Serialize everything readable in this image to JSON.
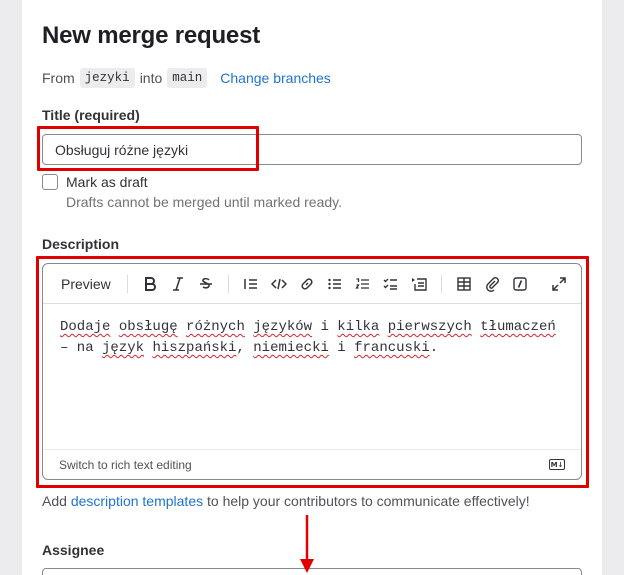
{
  "page": {
    "title": "New merge request"
  },
  "branches": {
    "from_label": "From",
    "source": "jezyki",
    "into_label": "into",
    "target": "main",
    "change_link": "Change branches"
  },
  "title_field": {
    "label": "Title (required)",
    "value": "Obsługuj różne języki"
  },
  "draft": {
    "label": "Mark as draft",
    "help": "Drafts cannot be merged until marked ready."
  },
  "description": {
    "label": "Description",
    "preview_tab": "Preview",
    "toolbar_icons": [
      "bold-icon",
      "italic-icon",
      "strikethrough-icon",
      "numbered-list-icon",
      "code-icon",
      "link-icon",
      "bullet-list-icon",
      "ordered-list-icon",
      "task-list-icon",
      "collapsible-section-icon",
      "table-icon",
      "attach-file-icon",
      "quick-actions-icon",
      "fullscreen-icon"
    ],
    "text_line1_parts": [
      "Dodaje",
      " ",
      "obsługę",
      " ",
      "różnych",
      " ",
      "języków",
      " i ",
      "kilka",
      " ",
      "pierwszych",
      " ",
      "tłumaczeń"
    ],
    "text_line2_parts": [
      "– na ",
      "język",
      " ",
      "hiszpański",
      ", ",
      "niemiecki",
      " i ",
      "francuski",
      "."
    ],
    "switch_label": "Switch to rich text editing",
    "markdown_badge": "M↓"
  },
  "templates": {
    "prefix": "Add ",
    "link": "description templates",
    "suffix": " to help your contributors to communicate effectively!"
  },
  "assignee": {
    "label": "Assignee"
  },
  "colors": {
    "highlight": "#e00000",
    "link": "#1f75cb",
    "spellcheck": "#d0262b"
  }
}
